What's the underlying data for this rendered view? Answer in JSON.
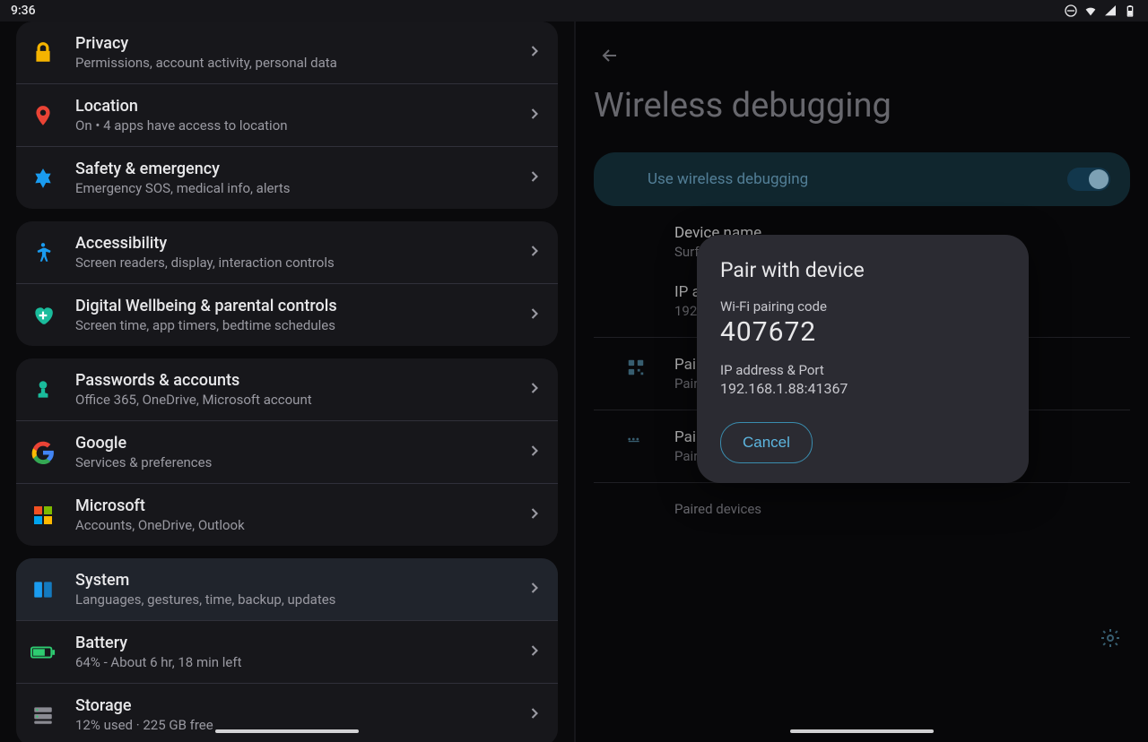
{
  "status": {
    "time": "9:36"
  },
  "settings_groups": [
    {
      "items": [
        {
          "id": "privacy",
          "icon": "lock",
          "title": "Privacy",
          "sub": "Permissions, account activity, personal data"
        },
        {
          "id": "location",
          "icon": "pin",
          "title": "Location",
          "sub": "On • 4 apps have access to location"
        },
        {
          "id": "safety",
          "icon": "med",
          "title": "Safety & emergency",
          "sub": "Emergency SOS, medical info, alerts"
        }
      ]
    },
    {
      "items": [
        {
          "id": "accessibility",
          "icon": "person",
          "title": "Accessibility",
          "sub": "Screen readers, display, interaction controls"
        },
        {
          "id": "wellbeing",
          "icon": "heart",
          "title": "Digital Wellbeing & parental controls",
          "sub": "Screen time, app timers, bedtime schedules"
        }
      ]
    },
    {
      "items": [
        {
          "id": "passwords",
          "icon": "key",
          "title": "Passwords & accounts",
          "sub": "Office 365, OneDrive, Microsoft account"
        },
        {
          "id": "google",
          "icon": "google",
          "title": "Google",
          "sub": "Services & preferences"
        },
        {
          "id": "microsoft",
          "icon": "ms",
          "title": "Microsoft",
          "sub": "Accounts, OneDrive, Outlook"
        }
      ]
    },
    {
      "items": [
        {
          "id": "system",
          "icon": "system",
          "title": "System",
          "sub": "Languages, gestures, time, backup, updates",
          "selected": true
        },
        {
          "id": "battery",
          "icon": "battery",
          "title": "Battery",
          "sub": "64% - About 6 hr, 18 min left"
        },
        {
          "id": "storage",
          "icon": "storage",
          "title": "Storage",
          "sub": "12% used · 225 GB free"
        }
      ]
    }
  ],
  "right": {
    "title": "Wireless debugging",
    "toggle_label": "Use wireless debugging",
    "toggle_on": true,
    "device_name_label": "Device name",
    "device_name_value": "Surface",
    "ip_label": "IP address",
    "ip_value": "192.168.1.88",
    "pair_qr_title": "Pair device with QR code",
    "pair_qr_sub": "Pair new devices using QR code",
    "pair_code_title": "Pair device with pairing code",
    "pair_code_sub": "Pair new devices using six digit code",
    "paired_header": "Paired devices"
  },
  "dialog": {
    "title": "Pair with device",
    "code_label": "Wi-Fi pairing code",
    "code": "407672",
    "ip_label": "IP address & Port",
    "ip_value": "192.168.1.88:41367",
    "cancel": "Cancel"
  }
}
